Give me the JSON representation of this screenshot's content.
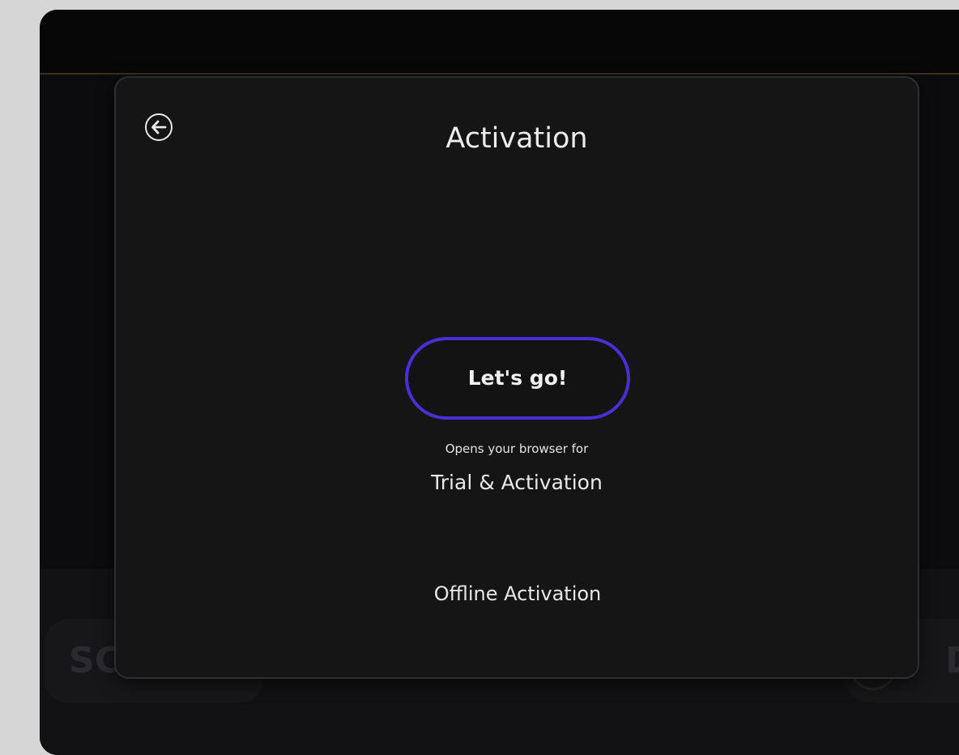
{
  "background": {
    "left_button_label": "SC",
    "right_button_label": "D"
  },
  "dialog": {
    "title": "Activation",
    "back_icon": "back-arrow-circle-icon",
    "primary_button_label": "Let's go!",
    "hint_line1": "Opens your browser for",
    "hint_line2": "Trial & Activation",
    "offline_link_label": "Offline Activation"
  },
  "colors": {
    "accent": "#4b2fd6",
    "dialog_bg": "#151516",
    "window_bg": "#0a0a0c",
    "outer_bg": "#d6d6d6"
  }
}
